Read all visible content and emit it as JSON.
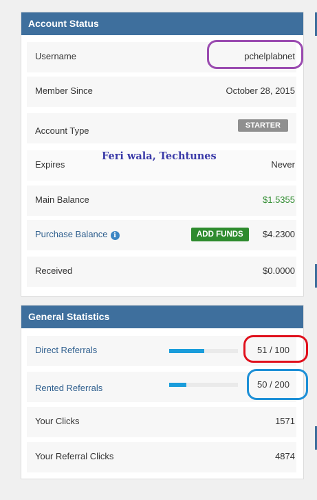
{
  "account_status": {
    "title": "Account Status",
    "username": {
      "label": "Username",
      "value": "pchelplabnet"
    },
    "member_since": {
      "label": "Member Since",
      "value": "October 28, 2015"
    },
    "account_type": {
      "label": "Account Type",
      "badge": "STARTER"
    },
    "expires": {
      "label": "Expires",
      "value": "Never"
    },
    "main_balance": {
      "label": "Main Balance",
      "value": "$1.5355"
    },
    "purchase_balance": {
      "label": "Purchase Balance",
      "button": "ADD FUNDS",
      "value": "$4.2300",
      "icon": "info-icon"
    },
    "received": {
      "label": "Received",
      "value": "$0.0000"
    }
  },
  "general_statistics": {
    "title": "General Statistics",
    "direct_referrals": {
      "label": "Direct Referrals",
      "value": "51 / 100",
      "progress": 0.51
    },
    "rented_referrals": {
      "label": "Rented Referrals",
      "value": "50 / 200",
      "progress": 0.25
    },
    "your_clicks": {
      "label": "Your Clicks",
      "value": "1571"
    },
    "your_referral_clicks": {
      "label": "Your Referral Clicks",
      "value": "4874"
    }
  },
  "watermark": "Feri wala, Techtunes",
  "colors": {
    "header": "#3e6f9d",
    "add_funds": "#2e8b2e",
    "progress": "#1a9ddb",
    "ring_purple": "#9a4bb0",
    "ring_red": "#e0101c",
    "ring_blue": "#1c8fd6"
  }
}
